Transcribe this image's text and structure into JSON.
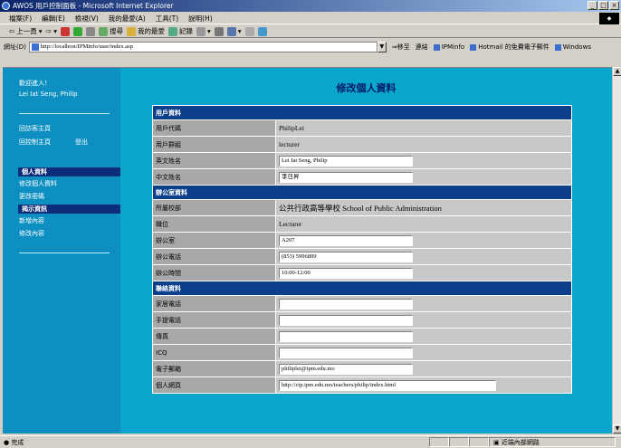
{
  "browser": {
    "title": "AWOS 用戶控制面板 - Microsoft Internet Explorer",
    "menu": [
      "檔案(F)",
      "編輯(E)",
      "檢視(V)",
      "我的最愛(A)",
      "工具(T)",
      "說明(H)"
    ],
    "toolbar": {
      "back": "上一頁",
      "search": "搜尋",
      "favorites": "我的最愛",
      "history": "記錄"
    },
    "address_label": "網址(D)",
    "address": "http://localhost/IPMinfo/user/index.asp",
    "go": "移至",
    "links_label": "連結",
    "links": [
      "IPMinfo",
      "Hotmail 的免費電子郵件",
      "Windows"
    ],
    "status_left": "完成",
    "status_right": "近端內部網路",
    "colors": {
      "title_start": "#0a246a",
      "page_bg": "#0aa5cc",
      "sidebar_bg": "#0d8fc2",
      "section": "#0b3f8c"
    }
  },
  "sidebar": {
    "welcome": "歡迎進入！",
    "user": "Lei Iat Seng, Philip",
    "links": {
      "visitor_home": "回訪客主頁",
      "control_home": "回控制主頁",
      "logout": "登出"
    },
    "personal_header": "個人資料",
    "personal_items": [
      "修改個人資料",
      "更改密碼"
    ],
    "notice_header": "揭示資訊",
    "notice_items": [
      "新增內容",
      "修改內容"
    ]
  },
  "page": {
    "title": "修改個人資料"
  },
  "form": {
    "sections": [
      {
        "title": "用戶資料",
        "rows": [
          {
            "label": "用戶代碼",
            "value": "PhilipLei",
            "type": "text"
          },
          {
            "label": "用戶群組",
            "value": "lecturer",
            "type": "text"
          },
          {
            "label": "英文姓名",
            "value": "Lei Iat Seng, Philip",
            "type": "input"
          },
          {
            "label": "中文姓名",
            "value": "李日昇",
            "type": "input"
          }
        ]
      },
      {
        "title": "辦公室資料",
        "rows": [
          {
            "label": "所屬校部",
            "value": "公共行政高等學校 School of Public Administration",
            "type": "text"
          },
          {
            "label": "職位",
            "value": "Lecturer",
            "type": "text"
          },
          {
            "label": "辦公室",
            "value": "A207",
            "type": "input"
          },
          {
            "label": "辦公電話",
            "value": "(853) 5996809",
            "type": "input"
          },
          {
            "label": "辦公時間",
            "value": "10:00-12:00",
            "type": "input"
          }
        ]
      },
      {
        "title": "聯絡資料",
        "rows": [
          {
            "label": "家居電話",
            "value": "",
            "type": "input"
          },
          {
            "label": "手提電話",
            "value": "",
            "type": "input"
          },
          {
            "label": "傳真",
            "value": "",
            "type": "input"
          },
          {
            "label": "ICQ",
            "value": "",
            "type": "input"
          },
          {
            "label": "電子郵箱",
            "value": "philiplei@ipm.edu.mo",
            "type": "input"
          },
          {
            "label": "個人網頁",
            "value": "http://ctp.ipm.edu.mo/teachers/philip/index.html",
            "type": "input_wide"
          }
        ]
      }
    ]
  }
}
